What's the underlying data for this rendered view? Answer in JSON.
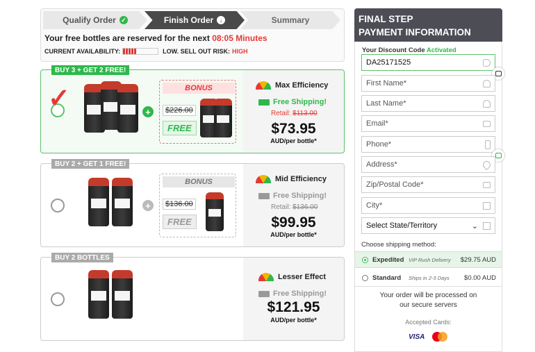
{
  "steps": {
    "s1": "Qualify Order",
    "s2": "Finish Order",
    "s3": "Summary"
  },
  "reserve": {
    "text": "Your free bottles are reserved for the next",
    "time": "08:05 Minutes"
  },
  "availability": {
    "label": "CURRENT AVAILABILITY:",
    "risk_label": "LOW. SELL OUT RISK:",
    "risk_value": "HIGH"
  },
  "offers": [
    {
      "tag": "BUY 3 + GET 2 FREE!",
      "bonus": "BONUS",
      "bonus_old_price": "$226.00",
      "bonus_free": "FREE",
      "efficiency": "Max Efficiency",
      "shipping": "Free Shipping!",
      "retail_label": "Retail:",
      "retail_price": "$113.00",
      "price": "$73.95",
      "per_bottle": "AUD/per bottle*"
    },
    {
      "tag": "BUY 2 + GET 1 FREE!",
      "bonus": "BONUS",
      "bonus_old_price": "$136.00",
      "bonus_free": "FREE",
      "efficiency": "Mid Efficiency",
      "shipping": "Free Shipping!",
      "retail_label": "Retail:",
      "retail_price": "$136.00",
      "price": "$99.95",
      "per_bottle": "AUD/per bottle*"
    },
    {
      "tag": "BUY 2 BOTTLES",
      "efficiency": "Lesser Effect",
      "shipping": "Free Shipping!",
      "price": "$121.95",
      "per_bottle": "AUD/per bottle*"
    }
  ],
  "payment": {
    "title1": "FINAL STEP",
    "title2": "PAYMENT INFORMATION",
    "discount_label": "Your Discount Code",
    "discount_status": "Activated",
    "discount_code": "DA25171525",
    "first_name": "First Name*",
    "last_name": "Last Name*",
    "email": "Email*",
    "phone": "Phone*",
    "address": "Address*",
    "zip": "Zip/Postal Code*",
    "city": "City*",
    "state": "Select State/Territory",
    "shipping_label": "Choose shipping method:",
    "ship_options": [
      {
        "name": "Expedited",
        "desc": "VIP Rush Delivery",
        "cost": "$29.75 AUD"
      },
      {
        "name": "Standard",
        "desc": "Ships in 2-3 Days",
        "cost": "$0.00 AUD"
      }
    ],
    "note1": "Your order will be processed on",
    "note2": "our secure servers",
    "accepted_cards": "Accepted Cards:",
    "visa": "VISA"
  },
  "colors": {
    "green": "#2eb84b",
    "red": "#e53935",
    "dark_header": "#4d4d56"
  }
}
